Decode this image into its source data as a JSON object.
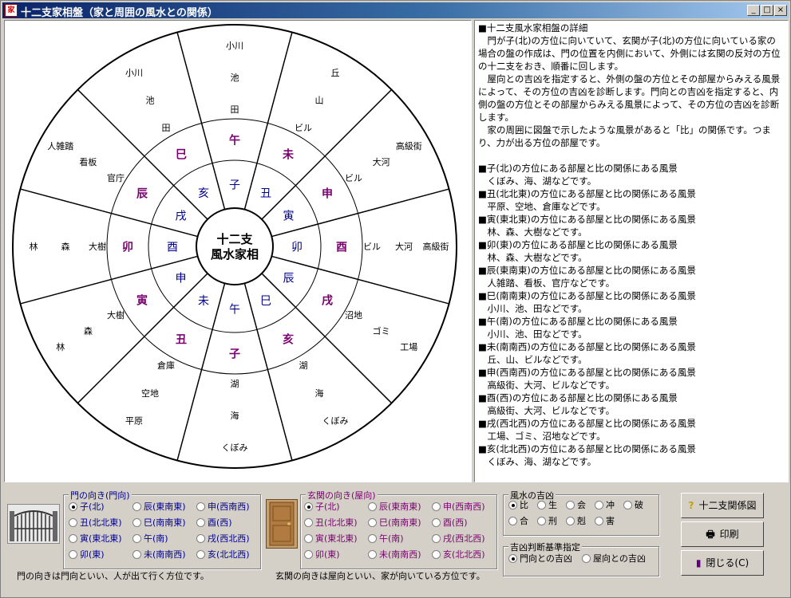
{
  "window": {
    "title": "十二支家相盤（家と周囲の風水との関係）",
    "icon_text": "家",
    "min_glyph": "_",
    "max_glyph": "□",
    "close_glyph": "×"
  },
  "board": {
    "center_line1": "十二支",
    "center_line2": "風水家相",
    "inner": [
      {
        "k": "子",
        "a": 0
      },
      {
        "k": "未",
        "a": 30
      },
      {
        "k": "申",
        "a": 60
      },
      {
        "k": "酉",
        "a": 90
      },
      {
        "k": "戌",
        "a": 120
      },
      {
        "k": "亥",
        "a": 150
      },
      {
        "k": "子",
        "a": 180
      },
      {
        "k": "丑",
        "a": 210
      },
      {
        "k": "寅",
        "a": 240
      },
      {
        "k": "卯",
        "a": 270
      },
      {
        "k": "辰",
        "a": 300
      },
      {
        "k": "巳",
        "a": 330
      }
    ],
    "outer_alt": [
      {
        "k": "午",
        "a": 0
      },
      {
        "k": "未",
        "a": 30
      },
      {
        "k": "申",
        "a": 60
      },
      {
        "k": "酉",
        "a": 90
      },
      {
        "k": "戌",
        "a": 120
      },
      {
        "k": "亥",
        "a": 150
      },
      {
        "k": "子",
        "a": 180
      },
      {
        "k": "丑",
        "a": 210
      },
      {
        "k": "寅",
        "a": 240
      },
      {
        "k": "卯",
        "a": 270
      },
      {
        "k": "辰",
        "a": 300
      },
      {
        "k": "巳",
        "a": 330
      }
    ],
    "middle": [
      {
        "k": "子",
        "a": 0
      },
      {
        "k": "丑",
        "a": 30
      },
      {
        "k": "寅",
        "a": 60
      },
      {
        "k": "卯",
        "a": 90
      },
      {
        "k": "辰",
        "a": 120
      },
      {
        "k": "巳",
        "a": 150
      },
      {
        "k": "午",
        "a": 180
      },
      {
        "k": "未",
        "a": 210
      },
      {
        "k": "申",
        "a": 240
      },
      {
        "k": "酉",
        "a": 270
      },
      {
        "k": "戌",
        "a": 300
      },
      {
        "k": "亥",
        "a": 330
      }
    ],
    "scenery": [
      {
        "a": 0,
        "w": [
          "小川",
          "池",
          "田"
        ]
      },
      {
        "a": 30,
        "w": [
          "丘",
          "山",
          "ビル"
        ]
      },
      {
        "a": 60,
        "w": [
          "高級街",
          "大河",
          "ビル"
        ]
      },
      {
        "a": 90,
        "w": [
          "高級街",
          "大河",
          "ビル"
        ]
      },
      {
        "a": 120,
        "w": [
          "工場",
          "ゴミ",
          "沼地"
        ]
      },
      {
        "a": 150,
        "w": [
          "くぼみ",
          "海",
          "湖"
        ]
      },
      {
        "a": 180,
        "w": [
          "くぼみ",
          "海",
          "湖"
        ]
      },
      {
        "a": 210,
        "w": [
          "平原",
          "空地",
          "倉庫"
        ]
      },
      {
        "a": 240,
        "w": [
          "林",
          "森",
          "大樹"
        ]
      },
      {
        "a": 270,
        "w": [
          "林",
          "森",
          "大樹"
        ]
      },
      {
        "a": 300,
        "w": [
          "人雑踏",
          "看板",
          "官庁"
        ]
      },
      {
        "a": 330,
        "w": [
          "小川",
          "池",
          "田"
        ]
      }
    ]
  },
  "description": [
    "■十二支風水家相盤の詳細",
    "　門が子(北)の方位に向いていて、玄関が子(北)の方位に向いている家の場合の盤の作成は、門の位置を内側において、外側には玄関の反対の方位の十二支をおき、順番に回します。",
    "　屋向との吉凶を指定すると、外側の盤の方位とその部屋からみえる風景によって、その方位の吉凶を診断します。門向との吉凶を指定すると、内側の盤の方位とその部屋からみえる風景によって、その方位の吉凶を診断します。",
    "　家の周囲に図盤で示したような風景があると「比」の関係です。つまり、力が出る方位の部屋です。",
    "",
    "■子(北)の方位にある部屋と比の関係にある風景",
    "　くぼみ、海、湖などです。",
    "■丑(北北東)の方位にある部屋と比の関係にある風景",
    "　平原、空地、倉庫などです。",
    "■寅(東北東)の方位にある部屋と比の関係にある風景",
    "　林、森、大樹などです。",
    "■卯(東)の方位にある部屋と比の関係にある風景",
    "　林、森、大樹などです。",
    "■辰(東南東)の方位にある部屋と比の関係にある風景",
    "　人雑踏、看板、官庁などです。",
    "■巳(南南東)の方位にある部屋と比の関係にある風景",
    "　小川、池、田などです。",
    "■午(南)の方位にある部屋と比の関係にある風景",
    "　小川、池、田などです。",
    "■未(南南西)の方位にある部屋と比の関係にある風景",
    "　丘、山、ビルなどです。",
    "■申(西南西)の方位にある部屋と比の関係にある風景",
    "　高級街、大河、ビルなどです。",
    "■酉(西)の方位にある部屋と比の関係にある風景",
    "　高級街、大河、ビルなどです。",
    "■戌(西北西)の方位にある部屋と比の関係にある風景",
    "　工場、ゴミ、沼地などです。",
    "■亥(北北西)の方位にある部屋と比の関係にある風景",
    "　くぼみ、海、湖などです。"
  ],
  "gate": {
    "legend": "門の向き(門向)",
    "options": [
      "子(北)",
      "辰(東南東)",
      "申(西南西)",
      "丑(北北東)",
      "巳(南南東)",
      "酉(西)",
      "寅(東北東)",
      "午(南)",
      "戌(西北西)",
      "卯(東)",
      "未(南南西)",
      "亥(北北西)"
    ],
    "selected": 0,
    "note": "門の向きは門向といい、人が出て行く方位です。"
  },
  "entrance": {
    "legend": "玄関の向き(屋向)",
    "options": [
      "子(北)",
      "辰(東南東)",
      "申(西南西)",
      "丑(北北東)",
      "巳(南南東)",
      "酉(西)",
      "寅(東北東)",
      "午(南)",
      "戌(西北西)",
      "卯(東)",
      "未(南南西)",
      "亥(北北西)"
    ],
    "selected": 0,
    "note": "玄関の向きは屋向といい、家が向いている方位です。"
  },
  "fengshui": {
    "legend": "風水の吉凶",
    "options": [
      "比",
      "生",
      "会",
      "冲",
      "破",
      "合",
      "刑",
      "剋",
      "害"
    ],
    "selected": 0
  },
  "criteria": {
    "legend": "吉凶判断基準指定",
    "options": [
      "門向との吉凶",
      "屋向との吉凶"
    ],
    "selected": 0
  },
  "buttons": {
    "relation": "十二支関係図",
    "print": "印刷",
    "close": "閉じる(C)"
  },
  "colors": {
    "title_start": "#0a246a",
    "title_end": "#a6caf0",
    "inner_text": "#00008b",
    "outer_text": "#7a0070"
  }
}
